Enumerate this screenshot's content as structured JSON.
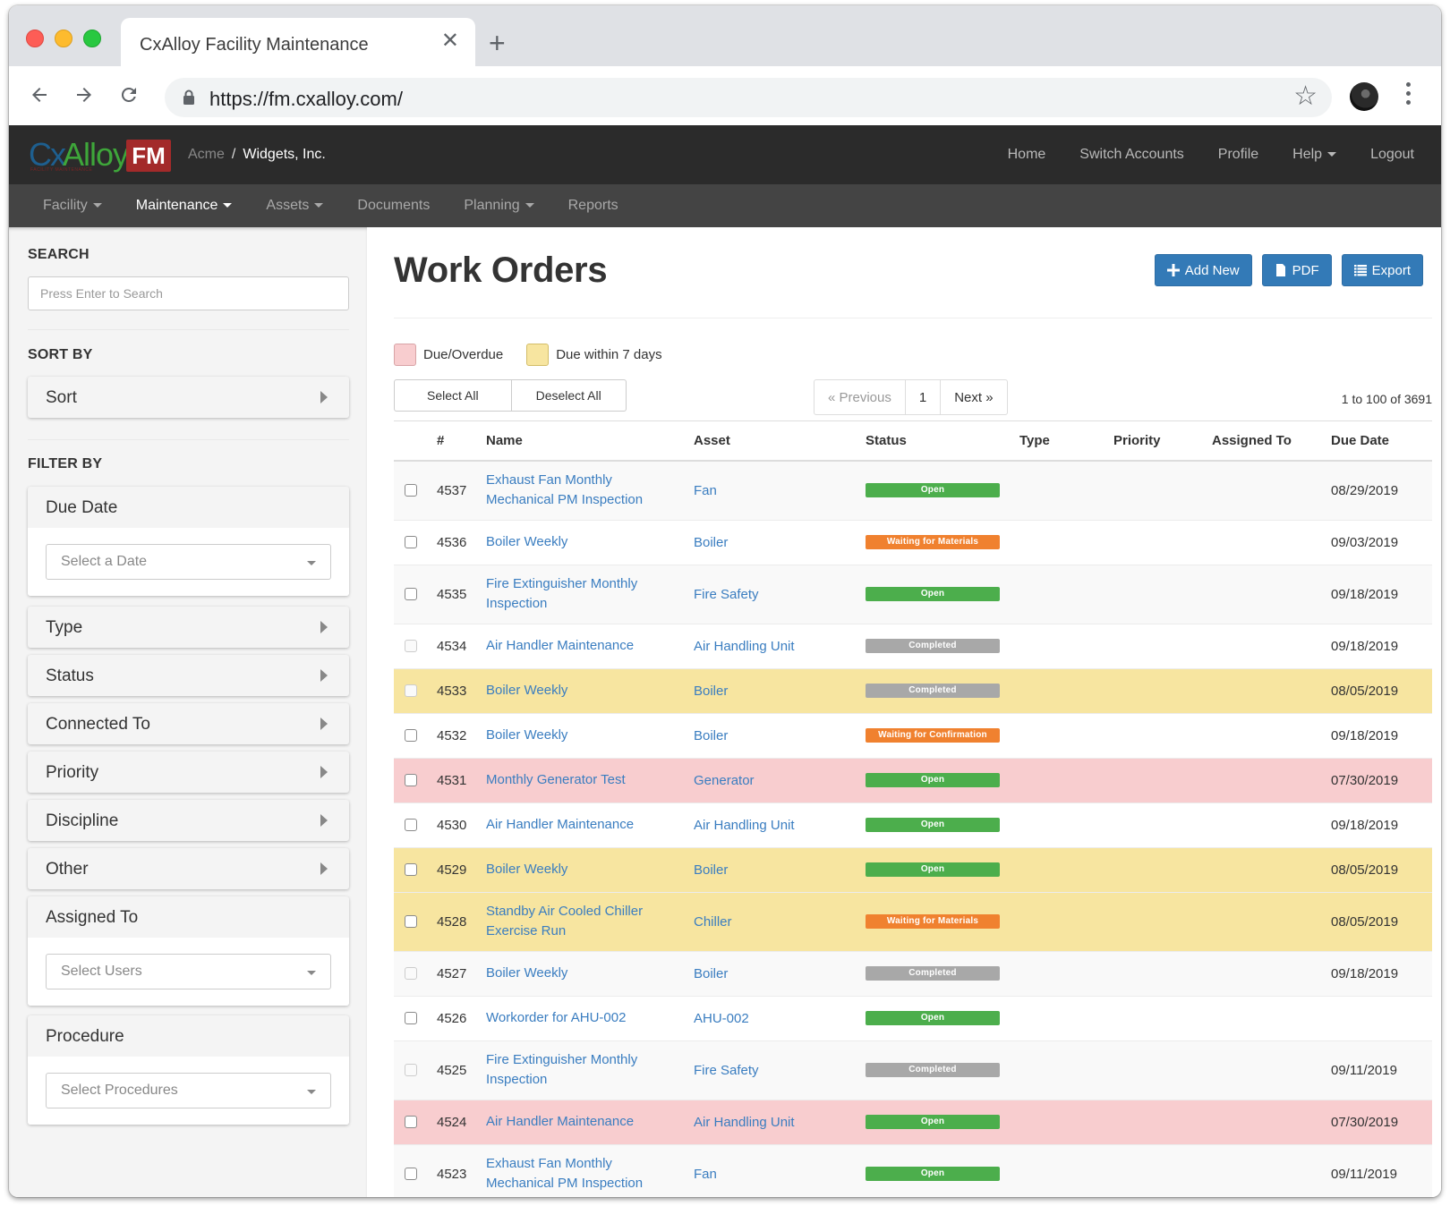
{
  "browser": {
    "tab_title": "CxAlloy Facility Maintenance",
    "url": "https://fm.cxalloy.com/"
  },
  "app": {
    "logo": {
      "cx": "Cx",
      "alloy": "Alloy",
      "fm": "FM",
      "subtitle": "FACILITY MAINTENANCE"
    },
    "breadcrumb": {
      "account": "Acme",
      "separator": "/",
      "project": "Widgets, Inc."
    },
    "top_links": [
      "Home",
      "Switch Accounts",
      "Profile",
      "Help",
      "Logout"
    ],
    "nav": [
      {
        "label": "Facility",
        "dropdown": true,
        "active": false
      },
      {
        "label": "Maintenance",
        "dropdown": true,
        "active": true
      },
      {
        "label": "Assets",
        "dropdown": true,
        "active": false
      },
      {
        "label": "Documents",
        "dropdown": false,
        "active": false
      },
      {
        "label": "Planning",
        "dropdown": true,
        "active": false
      },
      {
        "label": "Reports",
        "dropdown": false,
        "active": false
      }
    ]
  },
  "sidebar": {
    "search_label": "SEARCH",
    "search_placeholder": "Press Enter to Search",
    "sort_label": "SORT BY",
    "sort_panel": "Sort",
    "filter_label": "FILTER BY",
    "due_date": {
      "title": "Due Date",
      "placeholder": "Select a Date"
    },
    "filters": [
      "Type",
      "Status",
      "Connected To",
      "Priority",
      "Discipline",
      "Other"
    ],
    "assigned_to": {
      "title": "Assigned To",
      "placeholder": "Select Users"
    },
    "procedure": {
      "title": "Procedure",
      "placeholder": "Select Procedures"
    }
  },
  "main": {
    "title": "Work Orders",
    "buttons": {
      "add_new": "Add New",
      "pdf": "PDF",
      "export": "Export"
    },
    "legend": {
      "overdue": "Due/Overdue",
      "soon": "Due within 7 days"
    },
    "select_all": "Select All",
    "deselect_all": "Deselect All",
    "pager": {
      "previous": "« Previous",
      "page": "1",
      "next": "Next »"
    },
    "count": "1 to 100 of 3691",
    "columns": [
      "#",
      "Name",
      "Asset",
      "Status",
      "Type",
      "Priority",
      "Assigned To",
      "Due Date"
    ],
    "status_colors": {
      "Open": "#4cae4c",
      "Waiting for Materials": "#f0812f",
      "Waiting for Confirmation": "#f0812f",
      "Completed": "#a8a8a8"
    },
    "rows": [
      {
        "id": "4537",
        "name": "Exhaust Fan Monthly Mechanical PM Inspection",
        "asset": "Fan",
        "status": "Open",
        "type": "",
        "priority": "",
        "assigned": "",
        "due": "08/29/2019",
        "highlight": "",
        "completed": false,
        "tall": true
      },
      {
        "id": "4536",
        "name": "Boiler Weekly",
        "asset": "Boiler",
        "status": "Waiting for Materials",
        "type": "",
        "priority": "",
        "assigned": "",
        "due": "09/03/2019",
        "highlight": "",
        "completed": false,
        "tall": false
      },
      {
        "id": "4535",
        "name": "Fire Extinguisher Monthly Inspection",
        "asset": "Fire Safety",
        "status": "Open",
        "type": "",
        "priority": "",
        "assigned": "",
        "due": "09/18/2019",
        "highlight": "",
        "completed": false,
        "tall": true
      },
      {
        "id": "4534",
        "name": "Air Handler Maintenance",
        "asset": "Air Handling Unit",
        "status": "Completed",
        "type": "",
        "priority": "",
        "assigned": "",
        "due": "09/18/2019",
        "highlight": "",
        "completed": true,
        "tall": false
      },
      {
        "id": "4533",
        "name": "Boiler Weekly",
        "asset": "Boiler",
        "status": "Completed",
        "type": "",
        "priority": "",
        "assigned": "",
        "due": "08/05/2019",
        "highlight": "soon",
        "completed": true,
        "tall": false
      },
      {
        "id": "4532",
        "name": "Boiler Weekly",
        "asset": "Boiler",
        "status": "Waiting for Confirmation",
        "type": "",
        "priority": "",
        "assigned": "",
        "due": "09/18/2019",
        "highlight": "",
        "completed": false,
        "tall": false
      },
      {
        "id": "4531",
        "name": "Monthly Generator Test",
        "asset": "Generator",
        "status": "Open",
        "type": "",
        "priority": "",
        "assigned": "",
        "due": "07/30/2019",
        "highlight": "overdue",
        "completed": false,
        "tall": false
      },
      {
        "id": "4530",
        "name": "Air Handler Maintenance",
        "asset": "Air Handling Unit",
        "status": "Open",
        "type": "",
        "priority": "",
        "assigned": "",
        "due": "09/18/2019",
        "highlight": "",
        "completed": false,
        "tall": false
      },
      {
        "id": "4529",
        "name": "Boiler Weekly",
        "asset": "Boiler",
        "status": "Open",
        "type": "",
        "priority": "",
        "assigned": "",
        "due": "08/05/2019",
        "highlight": "soon",
        "completed": false,
        "tall": false
      },
      {
        "id": "4528",
        "name": "Standby Air Cooled Chiller Exercise Run",
        "asset": "Chiller",
        "status": "Waiting for Materials",
        "type": "",
        "priority": "",
        "assigned": "",
        "due": "08/05/2019",
        "highlight": "soon",
        "completed": false,
        "tall": true
      },
      {
        "id": "4527",
        "name": "Boiler Weekly",
        "asset": "Boiler",
        "status": "Completed",
        "type": "",
        "priority": "",
        "assigned": "",
        "due": "09/18/2019",
        "highlight": "",
        "completed": true,
        "tall": false
      },
      {
        "id": "4526",
        "name": "Workorder for AHU-002",
        "asset": "AHU-002",
        "status": "Open",
        "type": "",
        "priority": "",
        "assigned": "",
        "due": "",
        "highlight": "",
        "completed": false,
        "tall": false
      },
      {
        "id": "4525",
        "name": "Fire Extinguisher Monthly Inspection",
        "asset": "Fire Safety",
        "status": "Completed",
        "type": "",
        "priority": "",
        "assigned": "",
        "due": "09/11/2019",
        "highlight": "",
        "completed": true,
        "tall": true
      },
      {
        "id": "4524",
        "name": "Air Handler Maintenance",
        "asset": "Air Handling Unit",
        "status": "Open",
        "type": "",
        "priority": "",
        "assigned": "",
        "due": "07/30/2019",
        "highlight": "overdue",
        "completed": false,
        "tall": false
      },
      {
        "id": "4523",
        "name": "Exhaust Fan Monthly Mechanical PM Inspection",
        "asset": "Fan",
        "status": "Open",
        "type": "",
        "priority": "",
        "assigned": "",
        "due": "09/11/2019",
        "highlight": "",
        "completed": false,
        "tall": true
      }
    ]
  }
}
